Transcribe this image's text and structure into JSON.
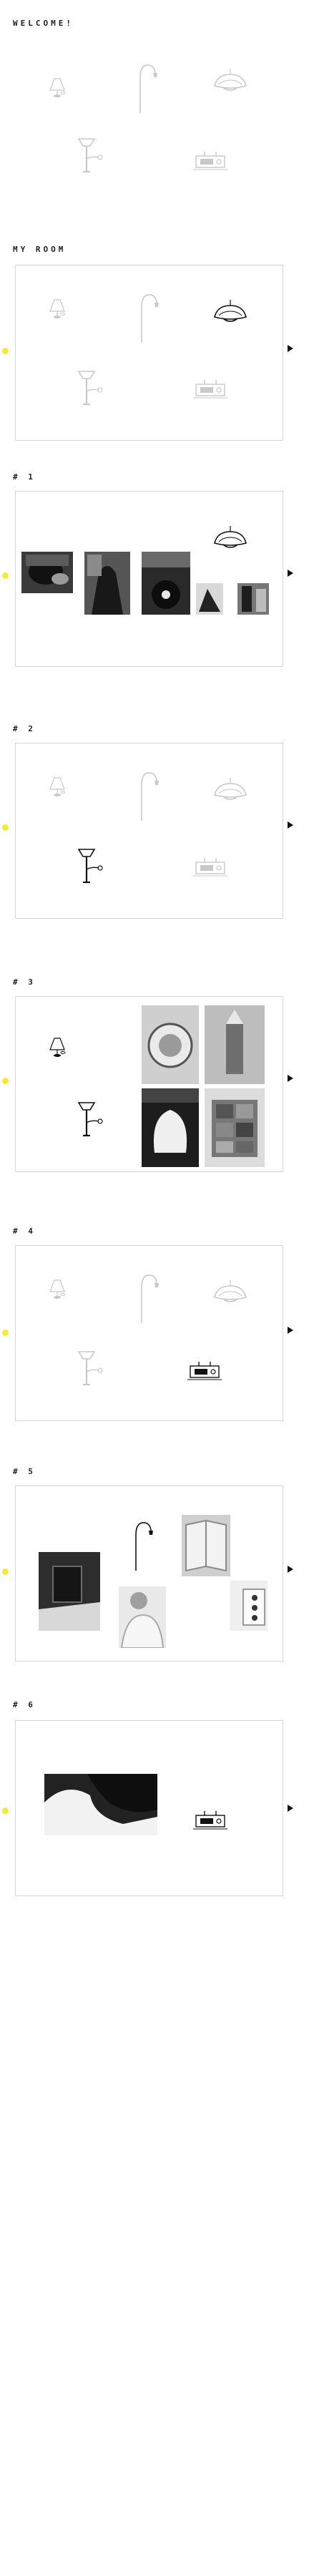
{
  "page": {
    "background": "#ffffff",
    "accent": "#f5ea3a"
  },
  "headings": {
    "welcome": "WELCOME!",
    "my_room": "MY ROOM",
    "s1": "# 1",
    "s2": "# 2",
    "s3": "# 3",
    "s4": "# 4",
    "s5": "# 5",
    "s6": "# 6"
  },
  "icons": {
    "prev": "yellow-dot-icon",
    "next": "right-arrow-icon",
    "objects": [
      "desk-lamp",
      "arc-floor-lamp",
      "pendant-lamp",
      "wall-lamp",
      "radio"
    ]
  }
}
